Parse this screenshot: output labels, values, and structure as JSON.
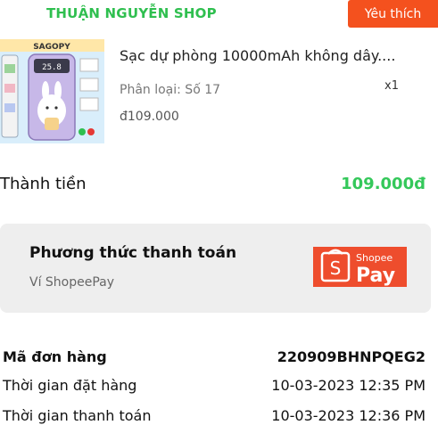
{
  "header": {
    "shop_name": "THUẬN NGUYỄN SHOP",
    "favorite_label": "Yêu thích"
  },
  "product": {
    "brand_text": "SAGOPY",
    "screen_text": "25.8",
    "name": "Sạc dự phòng 10000mAh không dây....",
    "variant": "Phân loại: Số 17",
    "quantity": "x1",
    "price": "đ109.000"
  },
  "total": {
    "label": "Thành tiền",
    "value": "109.000đ"
  },
  "payment": {
    "title": "Phương thức thanh toán",
    "method": "Ví ShopeePay",
    "logo_text_top": "Shopee",
    "logo_text_bottom": "Pay",
    "logo_color": "#ee4d2d"
  },
  "order": {
    "id_label": "Mã đơn hàng",
    "id_value": "220909BHNPQEG2",
    "order_time_label": "Thời gian đặt hàng",
    "order_time_value": "10-03-2023 12:35 PM",
    "pay_time_label": "Thời gian thanh toán",
    "pay_time_value": "10-03-2023 12:36 PM"
  }
}
